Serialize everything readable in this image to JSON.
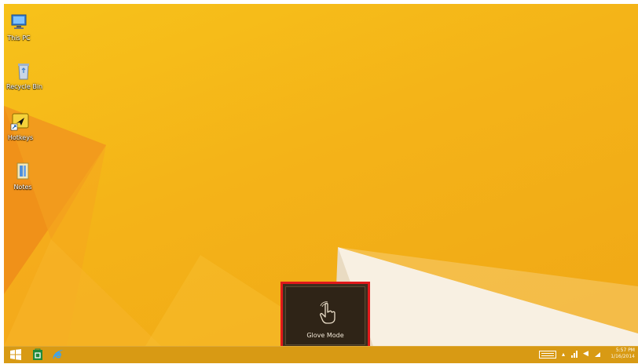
{
  "desktop": {
    "icons": [
      {
        "label": "This PC",
        "icon": "computer-icon"
      },
      {
        "label": "Recycle Bin",
        "icon": "recycle-bin-icon"
      },
      {
        "label": "Hotkeys",
        "icon": "shortcut-icon"
      },
      {
        "label": "Notes",
        "icon": "folder-icon"
      }
    ]
  },
  "osd": {
    "label": "Glove Mode",
    "icon": "hand-touch-icon",
    "highlight_color": "#e0191b"
  },
  "taskbar": {
    "buttons": [
      {
        "name": "start-button",
        "icon": "windows-logo-icon"
      },
      {
        "name": "store-button",
        "icon": "store-icon"
      },
      {
        "name": "internet-explorer-button",
        "icon": "internet-explorer-icon"
      }
    ],
    "tray": {
      "time": "5:57 PM",
      "date": "1/16/2014",
      "icons": [
        "keyboard-icon",
        "chevron-icon",
        "network-icon",
        "volume-icon",
        "battery-icon"
      ]
    }
  },
  "colors": {
    "wallpaper": "#f4b318",
    "taskbar": "#d89a14"
  }
}
